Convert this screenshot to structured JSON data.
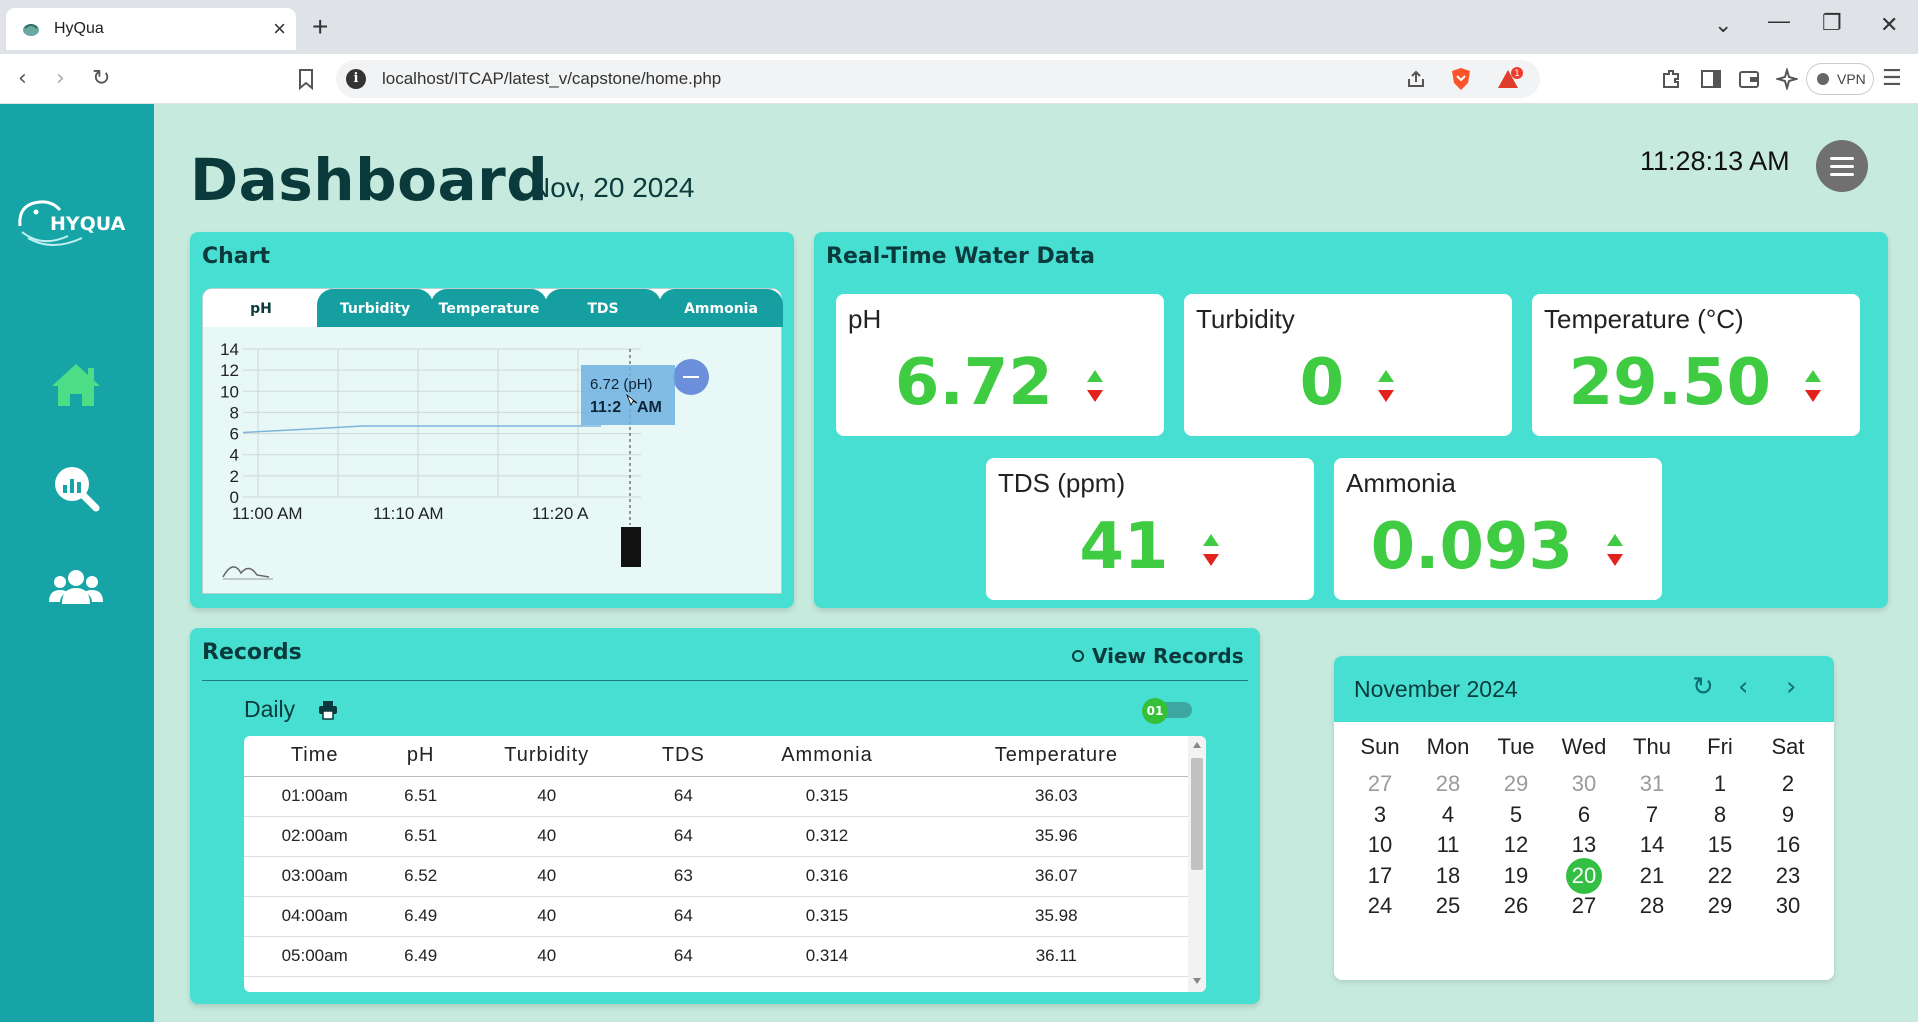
{
  "browser": {
    "tab_title": "HyQua",
    "tab_close": "×",
    "new_tab": "+",
    "url": "localhost/ITCAP/latest_v/capstone/home.php",
    "vpn_label": "VPN",
    "brave_badge": "1"
  },
  "sidebar": {
    "logo_text": "HYQUA",
    "items": [
      {
        "icon": "home-icon"
      },
      {
        "icon": "analytics-icon"
      },
      {
        "icon": "users-icon"
      }
    ]
  },
  "header": {
    "title": "Dashboard",
    "date": "Nov, 20 2024",
    "clock": "11:28:13 AM"
  },
  "chart_card": {
    "title": "Chart",
    "tabs": [
      "pH",
      "Turbidity",
      "Temperature",
      "TDS",
      "Ammonia"
    ],
    "active_tab": "pH",
    "tooltip_value": "6.72 (pH)",
    "tooltip_time": "11:2",
    "tooltip_time_suffix": "AM"
  },
  "chart_data": {
    "type": "line",
    "x": [
      "11:00 AM",
      "11:03 AM",
      "11:05 AM",
      "11:10 AM",
      "11:15 AM",
      "11:20 AM",
      "11:28 AM"
    ],
    "series": [
      {
        "values": [
          6.1,
          6.4,
          6.72,
          6.72,
          6.72,
          6.72,
          6.72
        ],
        "color": "#7fb4dd"
      }
    ],
    "xticks": [
      "11:00 AM",
      "11:10 AM",
      "11:20 A"
    ],
    "yticks": [
      "0",
      "2",
      "4",
      "6",
      "8",
      "10",
      "12",
      "14"
    ],
    "ylim": [
      0,
      14
    ],
    "grid": true
  },
  "realtime": {
    "title": "Real-Time Water Data",
    "items": [
      {
        "label": "pH",
        "value": "6.72"
      },
      {
        "label": "Turbidity",
        "value": "0"
      },
      {
        "label": "Temperature (°C)",
        "value": "29.50"
      },
      {
        "label": "TDS (ppm)",
        "value": "41"
      },
      {
        "label": "Ammonia",
        "value": "0.093"
      }
    ],
    "value_color": "#3fcc42"
  },
  "records": {
    "title": "Records",
    "view_link": "View Records",
    "period": "Daily",
    "toggle_label": "01",
    "columns": [
      "Time",
      "pH",
      "Turbidity",
      "TDS",
      "Ammonia",
      "Temperature"
    ],
    "rows": [
      [
        "01:00am",
        "6.51",
        "40",
        "64",
        "0.315",
        "36.03"
      ],
      [
        "02:00am",
        "6.51",
        "40",
        "64",
        "0.312",
        "35.96"
      ],
      [
        "03:00am",
        "6.52",
        "40",
        "63",
        "0.316",
        "36.07"
      ],
      [
        "04:00am",
        "6.49",
        "40",
        "64",
        "0.315",
        "35.98"
      ],
      [
        "05:00am",
        "6.49",
        "40",
        "64",
        "0.314",
        "36.11"
      ]
    ]
  },
  "calendar": {
    "month": "November 2024",
    "weekdays": [
      "Sun",
      "Mon",
      "Tue",
      "Wed",
      "Thu",
      "Fri",
      "Sat"
    ],
    "weeks": [
      [
        "27",
        "28",
        "29",
        "30",
        "31",
        "1",
        "2"
      ],
      [
        "3",
        "4",
        "5",
        "6",
        "7",
        "8",
        "9"
      ],
      [
        "10",
        "11",
        "12",
        "13",
        "14",
        "15",
        "16"
      ],
      [
        "17",
        "18",
        "19",
        "20",
        "21",
        "22",
        "23"
      ],
      [
        "24",
        "25",
        "26",
        "27",
        "28",
        "29",
        "30"
      ]
    ],
    "today": "20",
    "muted_prev_month": [
      "27",
      "28",
      "29",
      "30",
      "31"
    ]
  }
}
